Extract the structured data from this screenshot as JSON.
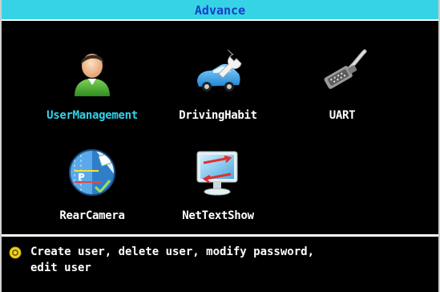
{
  "window": {
    "title": "Advance"
  },
  "menu": {
    "items": [
      {
        "label": "UserManagement",
        "icon": "user-icon",
        "selected": true
      },
      {
        "label": "DrivingHabit",
        "icon": "car-wrench-icon",
        "selected": false
      },
      {
        "label": "UART",
        "icon": "serial-cable-icon",
        "selected": false
      },
      {
        "label": "RearCamera",
        "icon": "rear-camera-icon",
        "selected": false
      },
      {
        "label": "NetTextShow",
        "icon": "monitor-network-icon",
        "selected": false
      }
    ]
  },
  "hint": {
    "text": "Create user, delete user, modify password,\nedit user",
    "icon": "info-bullet-icon"
  },
  "colors": {
    "title_bar": "#36d3e6",
    "title_text": "#1a3cc9",
    "selected_label": "#31d3ea",
    "background": "#000000"
  }
}
